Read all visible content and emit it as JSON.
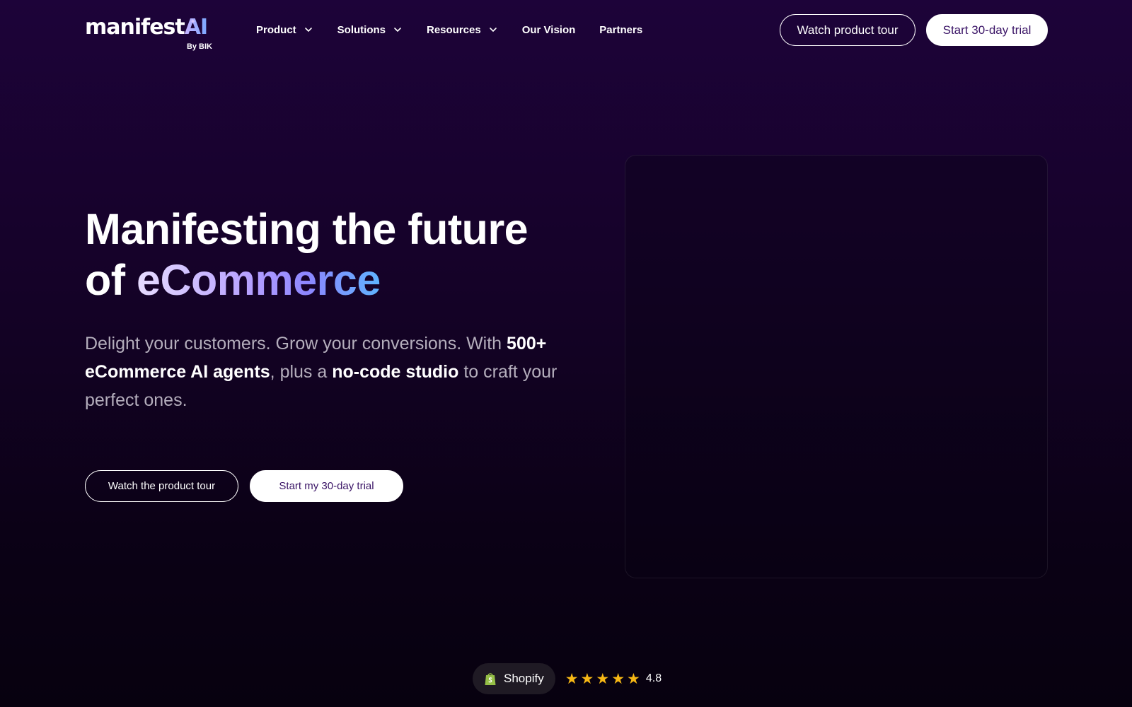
{
  "logo": {
    "name": "manifest",
    "ai": "AI",
    "by": "By BIK"
  },
  "nav": {
    "items": [
      {
        "label": "Product",
        "dropdown": true
      },
      {
        "label": "Solutions",
        "dropdown": true
      },
      {
        "label": "Resources",
        "dropdown": true
      },
      {
        "label": "Our Vision",
        "dropdown": false
      },
      {
        "label": "Partners",
        "dropdown": false
      }
    ],
    "tour_button": "Watch product tour",
    "trial_button": "Start 30-day trial"
  },
  "hero": {
    "title_line1": "Manifesting the future",
    "title_of": "of ",
    "title_highlight": "eCommerce",
    "sub_part1": "Delight your customers. Grow your conversions. With ",
    "sub_bold1": "500+ eCommerce AI agents",
    "sub_part2": ", plus a ",
    "sub_bold2": "no-code studio",
    "sub_part3": " to craft your perfect ones.",
    "tour_button": "Watch the product tour",
    "trial_button": "Start my 30-day trial"
  },
  "rating": {
    "platform": "Shopify",
    "stars": 5,
    "score": "4.8"
  },
  "colors": {
    "accent_text": "#3a1466",
    "star": "#f7b815",
    "shopify_green": "#95bf47"
  }
}
